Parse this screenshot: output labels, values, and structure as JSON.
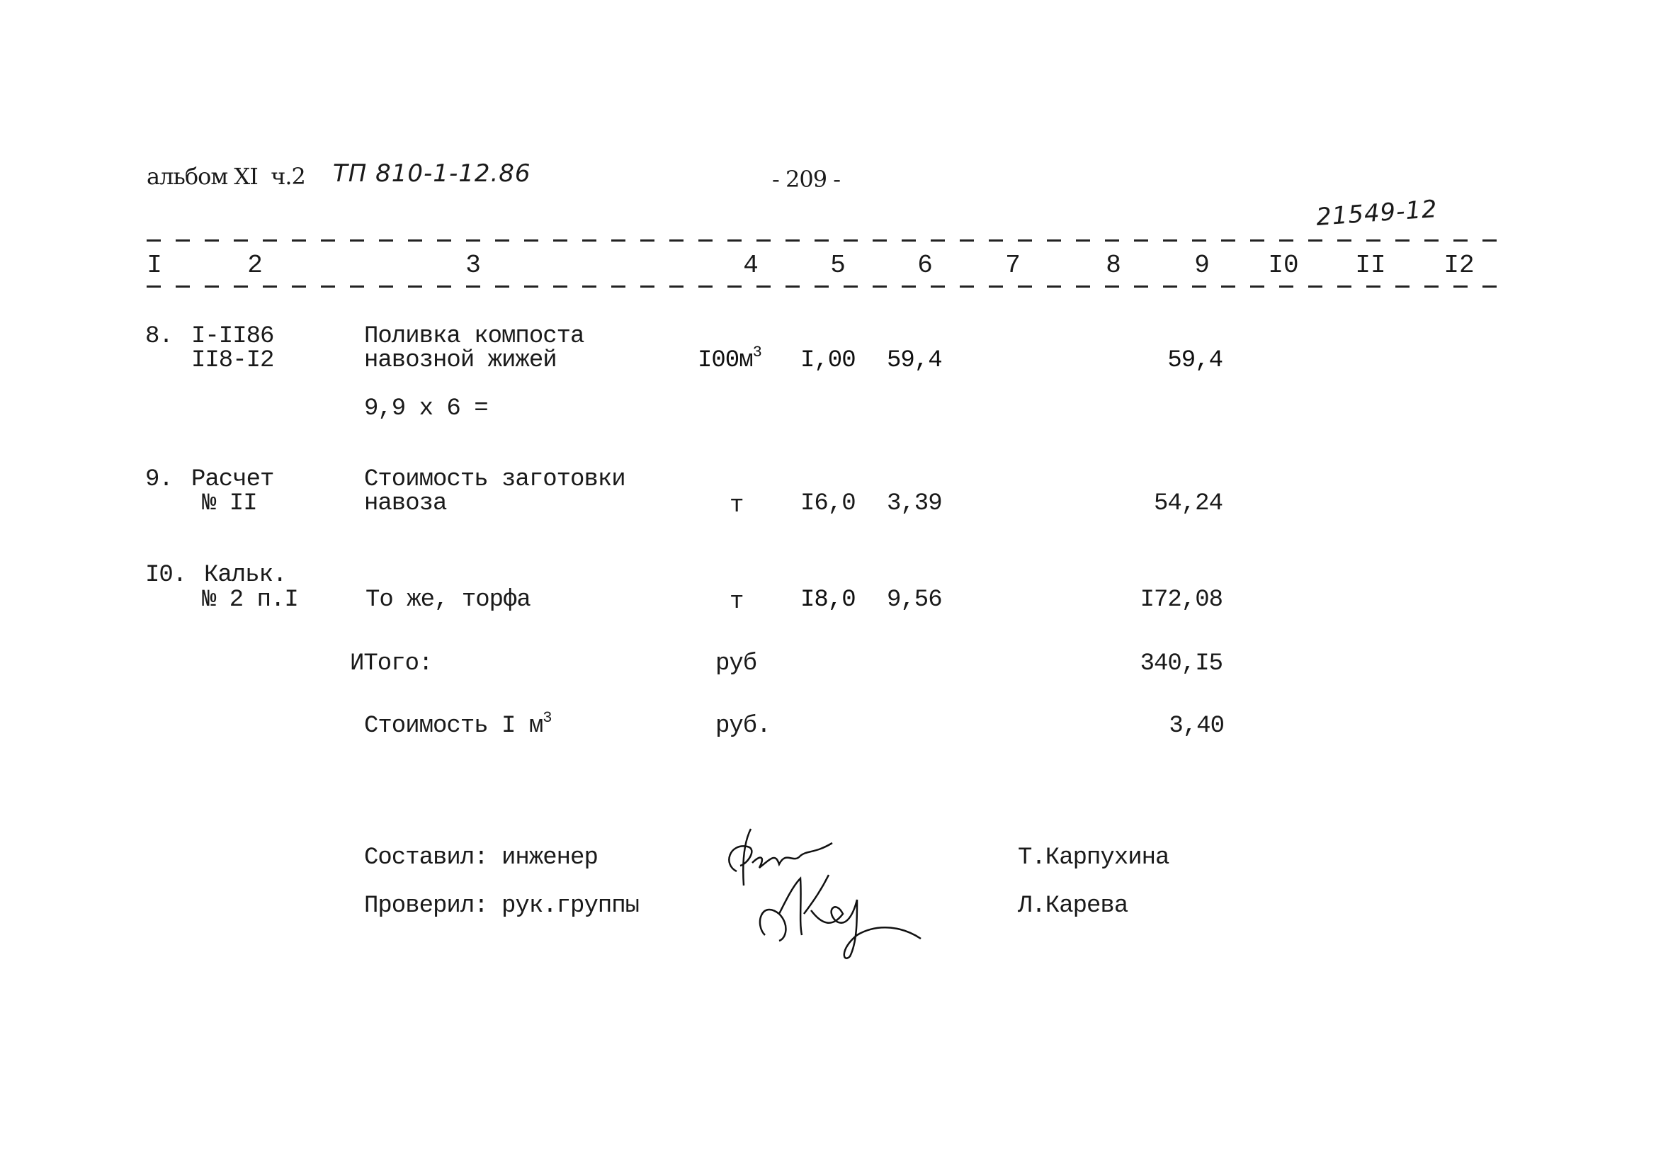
{
  "header": {
    "album": "альбом XI  ч.2",
    "project_code": "ТП 810-1-12.86",
    "page_number": "- 209 -",
    "archive_number": "21549-12"
  },
  "columns": [
    "I",
    "2",
    "3",
    "4",
    "5",
    "6",
    "7",
    "8",
    "9",
    "I0",
    "II",
    "I2"
  ],
  "rows": [
    {
      "index": "8.",
      "basis": [
        "I-II86",
        "II8-I2"
      ],
      "description": [
        "Поливка компоста",
        "навозной жижей"
      ],
      "note": "9,9 х 6 =",
      "unit": "I00м",
      "unit_sup": "3",
      "quantity": "I,00",
      "price": "59,4",
      "total": "59,4"
    },
    {
      "index": "9.",
      "basis": [
        "Расчет",
        "№ II"
      ],
      "description": [
        "Стоимость заготовки",
        "навоза"
      ],
      "unit": "т",
      "quantity": "I6,0",
      "price": "3,39",
      "total": "54,24"
    },
    {
      "index": "I0.",
      "basis": [
        "Кальк.",
        "№ 2 п.I"
      ],
      "description": [
        "То же, торфа"
      ],
      "unit": "т",
      "quantity": "I8,0",
      "price": "9,56",
      "total": "I72,08"
    }
  ],
  "summary": {
    "total_label": "ИТого:",
    "total_unit": "руб",
    "total_value": "340,I5",
    "unit_cost_label": "Стоимость I м",
    "unit_cost_sup": "3",
    "unit_cost_unit": "руб.",
    "unit_cost_value": "3,40"
  },
  "signatures": [
    {
      "role": "Составил: инженер",
      "name": "Т.Карпухина"
    },
    {
      "role": "Проверил: рук.группы",
      "name": "Л.Карева"
    }
  ]
}
